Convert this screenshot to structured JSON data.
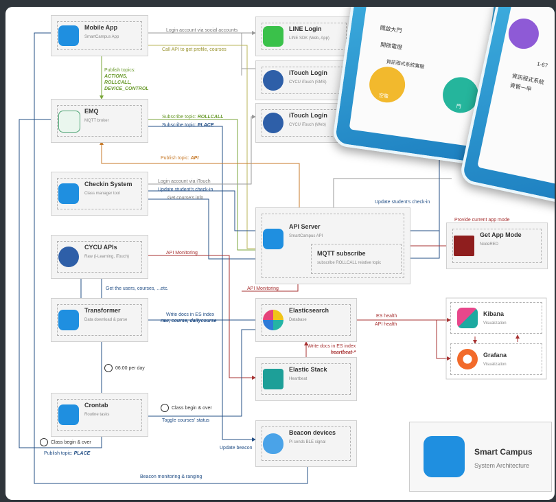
{
  "nodes": {
    "mobile": {
      "title": "Mobile App",
      "sub": "SmartCampus App",
      "icon": "smart-campus-icon"
    },
    "emq": {
      "title": "EMQ",
      "sub": "MQTT broker",
      "icon": "emq-icon"
    },
    "checkin": {
      "title": "Checkin System",
      "sub": "Class manager tool",
      "icon": "checkin-icon"
    },
    "cycu": {
      "title": "CYCU APIs",
      "sub": "Raw (i-Learning, iTouch)",
      "icon": "cycu-icon"
    },
    "transformer": {
      "title": "Transformer",
      "sub": "Data download & parse",
      "icon": "transformer-icon"
    },
    "crontab": {
      "title": "Crontab",
      "sub": "Routine tasks",
      "icon": "crontab-icon"
    },
    "line": {
      "title": "LINE Login",
      "sub": "LINE SDK (Web, App)",
      "icon": "line-icon"
    },
    "itouch_sms": {
      "title": "iTouch Login",
      "sub": "CYCU iTouch (SMS)",
      "icon": "itouch-icon"
    },
    "itouch_web": {
      "title": "iTouch Login",
      "sub": "CYCU iTouch (Web)",
      "icon": "itouch-icon"
    },
    "api": {
      "title": "API Server",
      "sub": "SmartCampus API",
      "icon": "api-server-icon"
    },
    "mqtt": {
      "title": "MQTT subscribe",
      "sub": "subscribe ROLLCALL relative topic"
    },
    "es": {
      "title": "Elasticsearch",
      "sub": "Database",
      "icon": "elasticsearch-icon"
    },
    "elastic": {
      "title": "Elastic Stack",
      "sub": "Heartbeat",
      "icon": "elastic-stack-icon"
    },
    "beacon": {
      "title": "Beacon devices",
      "sub": "Pi sends BLE signal",
      "icon": "beacon-icon"
    },
    "appmode": {
      "title": "Get App Mode",
      "sub": "NodeRED",
      "icon": "nodered-icon"
    },
    "kibana": {
      "title": "Kibana",
      "sub": "Visualization",
      "icon": "kibana-icon"
    },
    "grafana": {
      "title": "Grafana",
      "sub": "Visualization",
      "icon": "grafana-icon"
    }
  },
  "labels": {
    "login_social": "Login account via social accounts",
    "call_api": "Call API to get profile, courses",
    "publish_topics": "Publish topics:",
    "topic_actions": "ACTIONS,",
    "topic_rollcall": "ROLLCALL,",
    "topic_device": "DEVICE_CONTROL",
    "subscribe_rollcall_prefix": "Subscribe topic: ",
    "subscribe_rollcall_topic": "ROLLCALL",
    "subscribe_place_prefix": "Subscribe topic: ",
    "subscribe_place_topic": "PLACE",
    "publish_api_prefix": "Publish topic: ",
    "publish_api_topic": "API",
    "login_itouch": "Login account via iTouch",
    "update_checkin": "Update student's check-in",
    "get_course_info": "Get course's info",
    "update_checkin_right": "Update student's check-in",
    "provide_mode": "Provide current app mode",
    "api_monitoring": "API Monitoring",
    "api_monitoring2": "API Monitoring",
    "get_users": "Get the users, courses, ...etc.",
    "write_docs": "Write docs in ES index",
    "write_docs_indexes": "raw, course, dailycourse",
    "es_health": "ES health",
    "api_health": "API health",
    "write_docs_hb": "Write docs in ES index",
    "write_docs_hb_index": "heartbeat-*",
    "per_day": "06:00 per day",
    "class_begin": "Class begin & over",
    "toggle_status": "Toggle courses' status",
    "class_begin2": "Class begin & over",
    "publish_place_prefix": "Publish topic: ",
    "publish_place_topic": "PLACE",
    "update_beacon": "Update beacon",
    "beacon_monitoring": "Beacon monitoring & ranging"
  },
  "brand": {
    "title": "Smart Campus",
    "subtitle": "System Architecture"
  },
  "phone1": {
    "items": [
      "開啟大門",
      "開啟電燈",
      "資訊程式系統實驗",
      "空電",
      "門"
    ]
  },
  "phone2": {
    "items": [
      "資訊程式系統",
      "資管一甲",
      "1-67"
    ]
  },
  "colors": {
    "gray": "#999999",
    "green": "#7aa63a",
    "olive": "#b9b45a",
    "blue": "#234f86",
    "red": "#a73232",
    "orange": "#c77a2a",
    "accent": "#1f8fe0"
  }
}
